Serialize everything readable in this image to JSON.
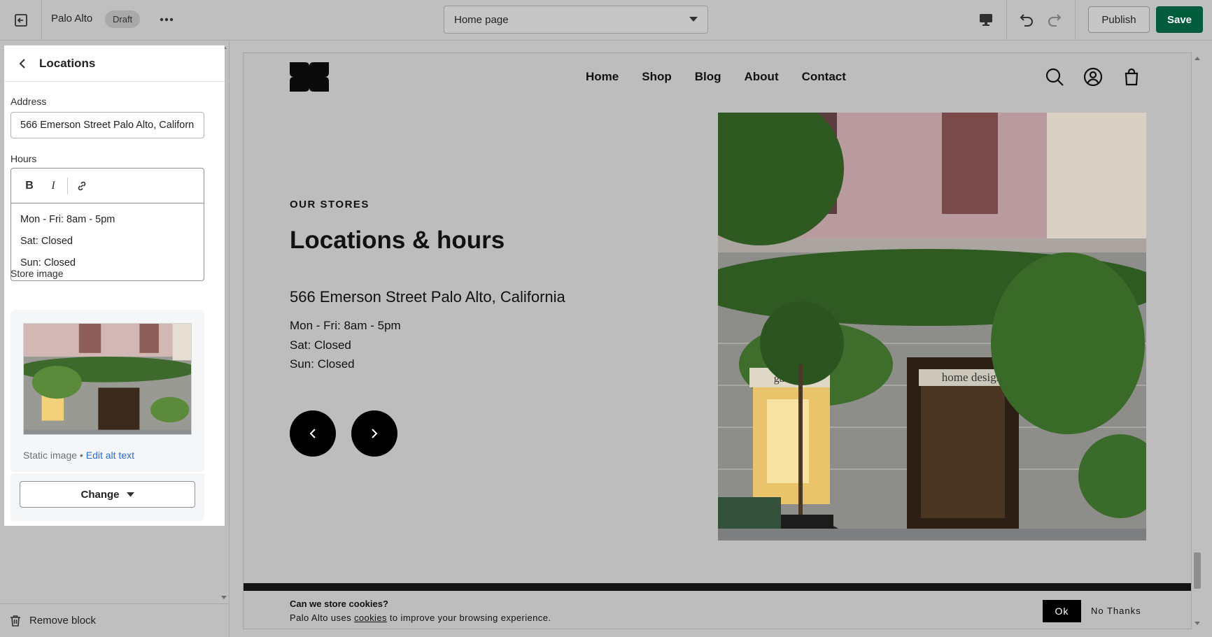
{
  "topbar": {
    "store_name": "Palo Alto",
    "status_badge": "Draft",
    "page_selector": "Home page",
    "publish_label": "Publish",
    "save_label": "Save",
    "colors": {
      "save": "#005c3a"
    }
  },
  "sidebar": {
    "panel_title": "Locations",
    "address": {
      "label": "Address",
      "value": "566 Emerson Street Palo Alto, California"
    },
    "hours": {
      "label": "Hours",
      "toolbar": [
        "B",
        "I",
        "link-icon"
      ],
      "lines": [
        "Mon - Fri: 8am - 5pm",
        "Sat: Closed",
        "Sun: Closed"
      ]
    },
    "store_image": {
      "label": "Store image",
      "meta_text": "Static image",
      "separator": " • ",
      "edit_alt_text": "Edit alt text",
      "change_label": "Change"
    },
    "footer_remove_label": "Remove block"
  },
  "preview": {
    "nav": [
      "Home",
      "Shop",
      "Blog",
      "About",
      "Contact"
    ],
    "eyebrow": "OUR STORES",
    "headline": "Locations & hours",
    "location_name": "566 Emerson Street Palo Alto, California",
    "hours": [
      "Mon - Fri: 8am - 5pm",
      "Sat: Closed",
      "Sun: Closed"
    ],
    "photo_signs": {
      "left": "gallery",
      "right": "home design"
    },
    "cookie": {
      "title": "Can we store cookies?",
      "text_before": "Palo Alto uses ",
      "link": "cookies",
      "text_after": " to improve your browsing experience.",
      "ok_label": "Ok",
      "no_thanks_label": "No Thanks"
    }
  }
}
